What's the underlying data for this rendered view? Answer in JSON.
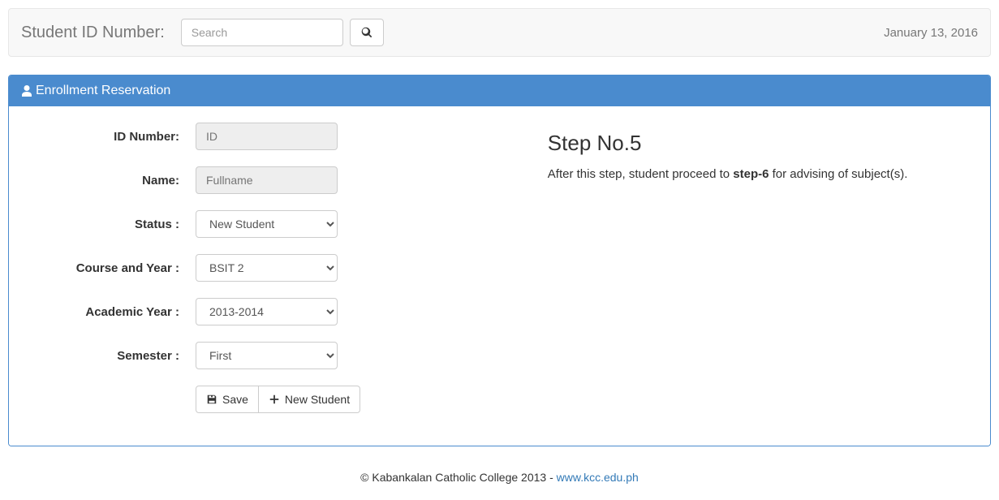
{
  "topbar": {
    "label": "Student ID Number:",
    "search_placeholder": "Search",
    "date": "January 13, 2016"
  },
  "panel": {
    "title": "Enrollment Reservation"
  },
  "form": {
    "id_label": "ID Number:",
    "id_placeholder": "ID",
    "name_label": "Name:",
    "name_placeholder": "Fullname",
    "status_label": "Status :",
    "status_value": "New Student",
    "course_label": "Course and Year :",
    "course_value": "BSIT 2",
    "ay_label": "Academic Year :",
    "ay_value": "2013-2014",
    "sem_label": "Semester :",
    "sem_value": "First",
    "save_label": "Save",
    "new_label": "New Student"
  },
  "info": {
    "step_title": "Step No.5",
    "step_prefix": "After this step, student proceed to ",
    "step_bold": "step-6",
    "step_suffix": " for advising of subject(s)."
  },
  "footer": {
    "text": "© Kabankalan Catholic College 2013 - ",
    "link_text": "www.kcc.edu.ph"
  }
}
